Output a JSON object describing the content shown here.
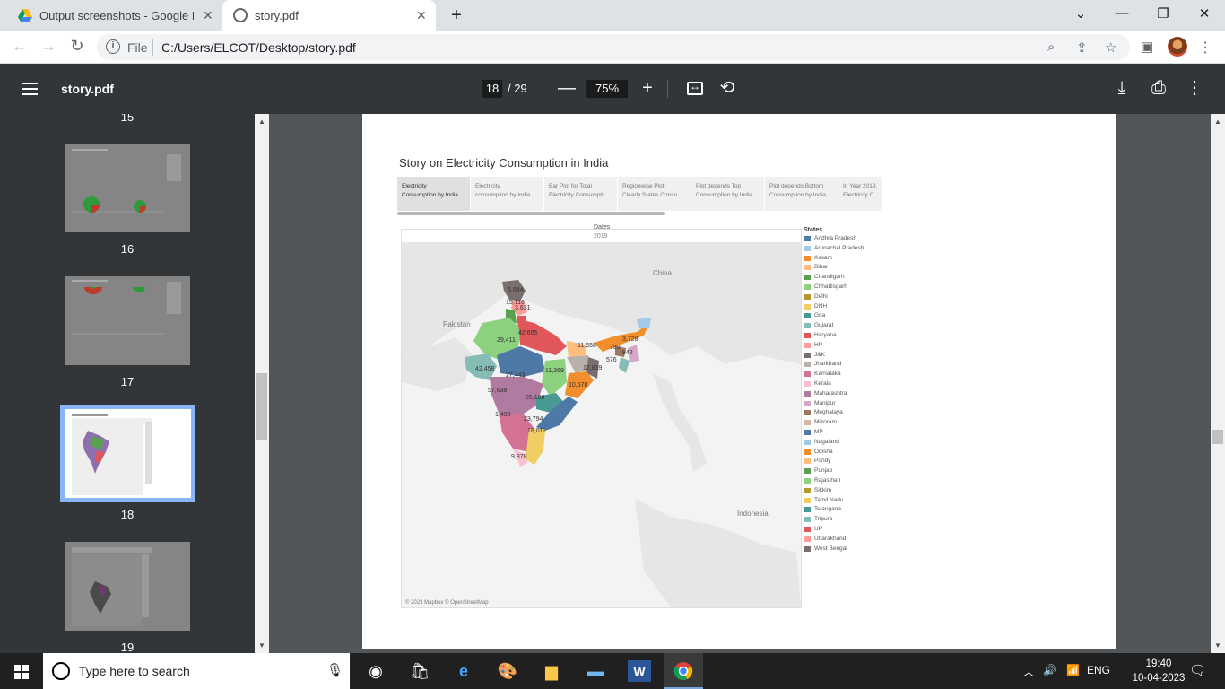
{
  "browser": {
    "tabs": [
      {
        "title": "Output screenshots - Google Drive",
        "active": false,
        "icon": "google-drive-icon"
      },
      {
        "title": "story.pdf",
        "active": true,
        "icon": "globe-icon"
      }
    ],
    "new_tab": "+",
    "address": {
      "scheme": "File",
      "url": "C:/Users/ELCOT/Desktop/story.pdf"
    },
    "window_controls": {
      "minimize": "⌄",
      "min": "—",
      "restore": "❐",
      "close": "✕"
    }
  },
  "pdf_viewer": {
    "doc_name": "story.pdf",
    "current_page": "18",
    "total_pages": "/ 29",
    "zoom": "75%",
    "zoom_out": "—",
    "zoom_in": "+"
  },
  "thumbnails": [
    {
      "page": "15"
    },
    {
      "page": "16"
    },
    {
      "page": "17"
    },
    {
      "page": "18",
      "selected": true
    },
    {
      "page": "19"
    }
  ],
  "story": {
    "title": "Story on Electricity Consumption in India",
    "points": [
      {
        "line1": "Electricity",
        "line2": "Consumption by India..",
        "active": true
      },
      {
        "line1": "Electricity",
        "line2": "consumption by India..."
      },
      {
        "line1": "Bar Plot for Total",
        "line2": "Electricity Consumpti..."
      },
      {
        "line1": "Regionwise Plot",
        "line2": "Clearly States Consu..."
      },
      {
        "line1": "Plot depends Top",
        "line2": "Consumption by India..."
      },
      {
        "line1": "Plot depends Bottom",
        "line2": "Consumption by India..."
      },
      {
        "line1": "In Year 2019,",
        "line2": "Electricity C..."
      }
    ],
    "map": {
      "filter_label": "Dates",
      "filter_value": "2019",
      "countries": [
        "China",
        "Pakistan",
        "Indonesia"
      ],
      "values": [
        "6,844",
        "15,116",
        "3,631",
        "42,605",
        "29,411",
        "11,556",
        "3,728",
        "789",
        "576",
        "942",
        "11,369",
        "12,839",
        "42,458",
        "27,443",
        "10,678",
        "57,638",
        "25,108",
        "1,499",
        "23,794",
        "18,011",
        "9,878"
      ],
      "attribution": "© 2023 Mapbox © OpenStreetMap"
    },
    "legend_title": "States",
    "legend": [
      {
        "name": "Andhra Pradesh",
        "color": "#4e79a7"
      },
      {
        "name": "Arunachal Pradesh",
        "color": "#a0cbe8"
      },
      {
        "name": "Assam",
        "color": "#f28e2b"
      },
      {
        "name": "Bihar",
        "color": "#ffbe7d"
      },
      {
        "name": "Chandigarh",
        "color": "#59a14f"
      },
      {
        "name": "Chhattisgarh",
        "color": "#8cd17d"
      },
      {
        "name": "Delhi",
        "color": "#b6992d"
      },
      {
        "name": "DNH",
        "color": "#f1ce63"
      },
      {
        "name": "Goa",
        "color": "#499894"
      },
      {
        "name": "Gujarat",
        "color": "#86bcb6"
      },
      {
        "name": "Haryana",
        "color": "#e15759"
      },
      {
        "name": "HP",
        "color": "#ff9d9a"
      },
      {
        "name": "J&K",
        "color": "#79706e"
      },
      {
        "name": "Jharkhand",
        "color": "#bab0ac"
      },
      {
        "name": "Karnataka",
        "color": "#d37295"
      },
      {
        "name": "Kerala",
        "color": "#fabfd2"
      },
      {
        "name": "Maharashtra",
        "color": "#b07aa1"
      },
      {
        "name": "Manipur",
        "color": "#d4a6c8"
      },
      {
        "name": "Meghalaya",
        "color": "#9d7660"
      },
      {
        "name": "Mizoram",
        "color": "#d7b5a6"
      },
      {
        "name": "MP",
        "color": "#4e79a7"
      },
      {
        "name": "Nagaland",
        "color": "#a0cbe8"
      },
      {
        "name": "Odisha",
        "color": "#f28e2b"
      },
      {
        "name": "Pondy",
        "color": "#ffbe7d"
      },
      {
        "name": "Punjab",
        "color": "#59a14f"
      },
      {
        "name": "Rajasthan",
        "color": "#8cd17d"
      },
      {
        "name": "Sikkim",
        "color": "#b6992d"
      },
      {
        "name": "Tamil Nadu",
        "color": "#f1ce63"
      },
      {
        "name": "Telangana",
        "color": "#499894"
      },
      {
        "name": "Tripura",
        "color": "#86bcb6"
      },
      {
        "name": "UP",
        "color": "#e15759"
      },
      {
        "name": "Uttarakhand",
        "color": "#ff9d9a"
      },
      {
        "name": "West Bengal",
        "color": "#79706e"
      }
    ]
  },
  "taskbar": {
    "search_placeholder": "Type here to search",
    "language": "ENG",
    "time": "19:40",
    "date": "10-04-2023"
  }
}
